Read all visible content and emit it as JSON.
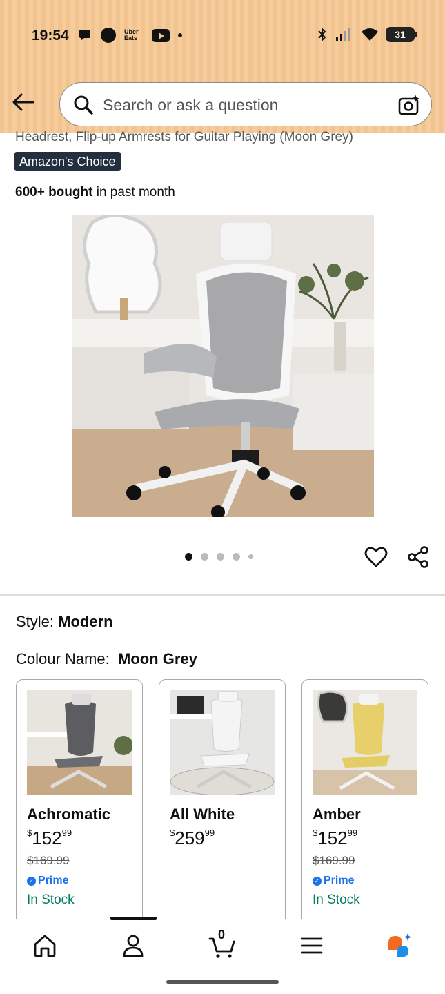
{
  "status_bar": {
    "time": "19:54",
    "uber_eats_label": "Uber Eats",
    "battery": "31",
    "icons": [
      "chat-icon",
      "circle-icon",
      "uber-eats-icon",
      "youtube-icon",
      "dot-icon",
      "bluetooth-icon",
      "signal-icon",
      "wifi-icon",
      "battery-icon"
    ]
  },
  "header": {
    "back_icon": "back-arrow-icon",
    "search_placeholder": "Search or ask a question",
    "search_icon": "search-icon",
    "camera_icon": "camera-search-icon"
  },
  "product": {
    "title_tail": "Headrest, Flip-up Armrests for Guitar Playing (Moon Grey)",
    "badge": "Amazon's Choice",
    "bought_bold": "600+ bought",
    "bought_rest": " in past month",
    "image_count": 5,
    "active_image": 1
  },
  "options": {
    "style_label": "Style:",
    "style_value": "Modern",
    "colour_label": "Colour Name:",
    "colour_value": "Moon Grey"
  },
  "variants": [
    {
      "name": "Achromatic",
      "price_symbol": "$",
      "price_whole": "152",
      "price_fraction": "99",
      "old_price": "$169.99",
      "prime": "Prime",
      "stock": "In Stock"
    },
    {
      "name": "All White",
      "price_symbol": "$",
      "price_whole": "259",
      "price_fraction": "99",
      "old_price": "",
      "prime": "",
      "stock": ""
    },
    {
      "name": "Amber",
      "price_symbol": "$",
      "price_whole": "152",
      "price_fraction": "99",
      "old_price": "$169.99",
      "prime": "Prime",
      "stock": "In Stock"
    }
  ],
  "bottom_nav": {
    "items": [
      "home-icon",
      "account-icon",
      "cart-icon",
      "menu-icon",
      "rufus-icon"
    ],
    "cart_count": "0",
    "active": "account-icon"
  },
  "colors": {
    "header_bg": "#f2c38e",
    "in_stock": "#067d62",
    "prime_blue": "#1a73e8",
    "badge_bg": "#232f3e"
  }
}
